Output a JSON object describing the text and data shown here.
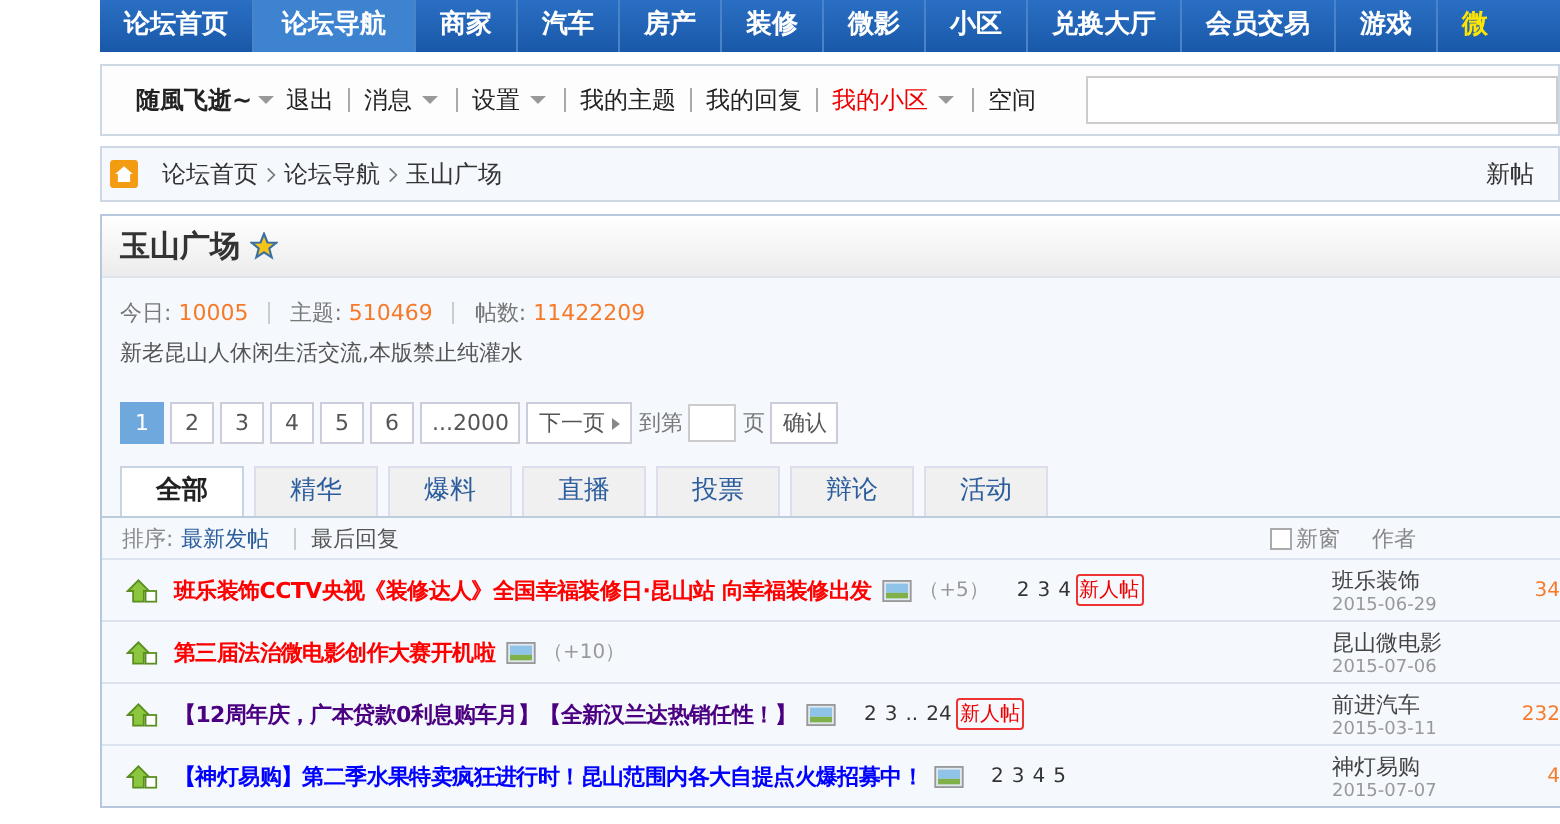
{
  "nav": [
    {
      "label": "论坛首页",
      "selected": false
    },
    {
      "label": "论坛导航",
      "selected": true
    },
    {
      "label": "商家",
      "selected": false
    },
    {
      "label": "汽车",
      "selected": false
    },
    {
      "label": "房产",
      "selected": false
    },
    {
      "label": "装修",
      "selected": false
    },
    {
      "label": "微影",
      "selected": false
    },
    {
      "label": "小区",
      "selected": false
    },
    {
      "label": "兑换大厅",
      "selected": false
    },
    {
      "label": "会员交易",
      "selected": false
    },
    {
      "label": "游戏",
      "selected": false
    },
    {
      "label": "微",
      "selected": false,
      "highlight": true
    }
  ],
  "user_bar": {
    "username": "随風飞逝~",
    "items": [
      {
        "label": "退出",
        "dropdown": false,
        "highlight": false
      },
      {
        "label": "消息",
        "dropdown": true,
        "highlight": false
      },
      {
        "label": "设置",
        "dropdown": true,
        "highlight": false
      },
      {
        "label": "我的主题",
        "dropdown": false,
        "highlight": false
      },
      {
        "label": "我的回复",
        "dropdown": false,
        "highlight": false
      },
      {
        "label": "我的小区",
        "dropdown": true,
        "highlight": true
      },
      {
        "label": "空间",
        "dropdown": false,
        "highlight": false
      }
    ]
  },
  "breadcrumb": {
    "items": [
      "论坛首页",
      "论坛导航",
      "玉山广场"
    ],
    "action": "新帖"
  },
  "forum": {
    "title": "玉山广场",
    "starred": true,
    "stats": [
      {
        "label": "今日:",
        "value": "10005"
      },
      {
        "label": "主题:",
        "value": "510469"
      },
      {
        "label": "帖数:",
        "value": "11422209"
      }
    ],
    "description": "新老昆山人休闲生活交流,本版禁止纯灌水"
  },
  "pagination": {
    "pages": [
      {
        "label": "1",
        "selected": true
      },
      {
        "label": "2",
        "selected": false
      },
      {
        "label": "3",
        "selected": false
      },
      {
        "label": "4",
        "selected": false
      },
      {
        "label": "5",
        "selected": false
      },
      {
        "label": "6",
        "selected": false
      },
      {
        "label": "...2000",
        "selected": false
      }
    ],
    "next": "下一页",
    "goto_prefix": "到第",
    "goto_suffix": "页",
    "confirm": "确认"
  },
  "tabs": [
    {
      "label": "全部",
      "selected": true
    },
    {
      "label": "精华",
      "selected": false
    },
    {
      "label": "爆料",
      "selected": false
    },
    {
      "label": "直播",
      "selected": false
    },
    {
      "label": "投票",
      "selected": false
    },
    {
      "label": "辩论",
      "selected": false
    },
    {
      "label": "活动",
      "selected": false
    }
  ],
  "sort": {
    "label": "排序:",
    "options": [
      {
        "label": "最新发帖",
        "selected": true
      },
      {
        "label": "最后回复",
        "selected": false
      }
    ],
    "new_window": {
      "label": "新窗",
      "checked": false
    },
    "author_header": "作者"
  },
  "threads": [
    {
      "title": "班乐装饰CCTV央视《装修达人》全国幸福装修日·昆山站 向幸福装修出发",
      "color": "#ff0000",
      "has_image": true,
      "extra": "（+5）",
      "pages": [
        "2",
        "3",
        "4"
      ],
      "newbie": "新人帖",
      "author": "班乐装饰",
      "date": "2015-06-29",
      "replies": "34"
    },
    {
      "title": "第三届法治微电影创作大赛开机啦",
      "color": "#ff0000",
      "has_image": true,
      "extra": "（+10）",
      "author": "昆山微电影",
      "date": "2015-07-06"
    },
    {
      "title": "【12周年庆，广本贷款0利息购车月】【全新汉兰达热销任性！】",
      "color": "#4b0082",
      "has_image": true,
      "pages": [
        "2",
        "3",
        "..",
        "24"
      ],
      "newbie": "新人帖",
      "author": "前进汽车",
      "date": "2015-03-11",
      "replies": "232"
    },
    {
      "title": "【神灯易购】第二季水果特卖疯狂进行时！昆山范围内各大自提点火爆招募中！",
      "color": "#0000ff",
      "has_image": true,
      "pages": [
        "2",
        "3",
        "4",
        "5"
      ],
      "author": "神灯易购",
      "date": "2015-07-07",
      "replies": "4"
    }
  ]
}
